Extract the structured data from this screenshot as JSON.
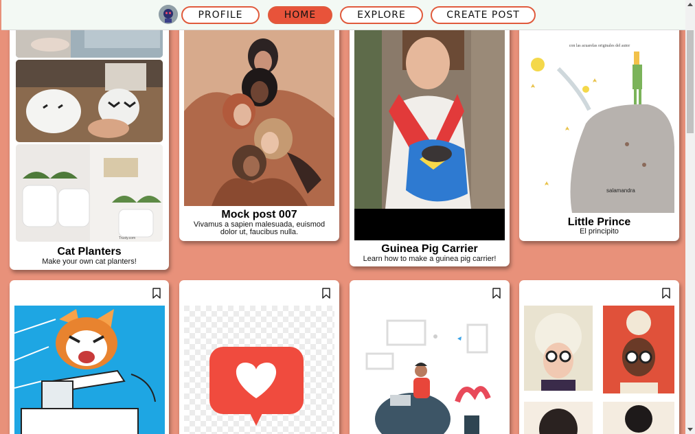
{
  "nav": {
    "profile": "PROFILE",
    "home": "HOME",
    "explore": "EXPLORE",
    "create_post": "CREATE POST",
    "active": "HOME"
  },
  "posts": [
    {
      "title": "Cat Planters",
      "description": "Make your own cat planters!",
      "image": "cat-planter-photos"
    },
    {
      "title": "Mock post 007",
      "description": "Vivamus a sapien malesuada, euismod dolor ut, faucibus nulla.",
      "image": "women-illustration"
    },
    {
      "title": "Guinea Pig Carrier",
      "description": "Learn how to make a guinea pig carrier!",
      "image": "girl-with-guinea-pig-carrier"
    },
    {
      "title": "Little Prince",
      "description": "El principito",
      "image": "little-prince-book-cover"
    },
    {
      "title": "",
      "description": "",
      "image": "aggretsuko-illustration"
    },
    {
      "title": "",
      "description": "",
      "image": "heart-notification-icon"
    },
    {
      "title": "",
      "description": "",
      "image": "man-with-laptop-illustration"
    },
    {
      "title": "",
      "description": "",
      "image": "women-portraits-illustration"
    }
  ],
  "book_cover_text": {
    "subtitle": "con las acuarelas originales del autor",
    "publisher": "salamandra",
    "watermark": "Trusty.com"
  },
  "colors": {
    "background": "#e8917a",
    "nav_background": "#f3f9f4",
    "accent": "#e8533a",
    "card": "#ffffff"
  }
}
